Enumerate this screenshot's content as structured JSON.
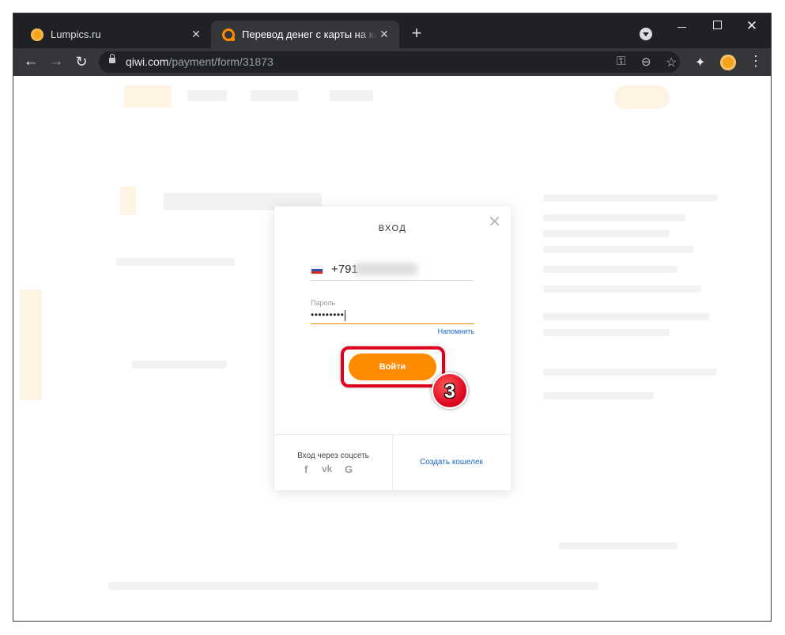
{
  "browser": {
    "tabs": [
      {
        "title": "Lumpics.ru",
        "close": "✕",
        "favicon": "lumpics-favicon"
      },
      {
        "title": "Перевод денег с карты на карту",
        "close": "✕",
        "favicon": "qiwi-favicon"
      }
    ],
    "new_tab": "+",
    "window_controls": {
      "close": "✕"
    },
    "url": {
      "host": "qiwi.com",
      "path": "/payment/form/31873"
    },
    "icons": {
      "back": "←",
      "forward": "→",
      "reload": "↻",
      "key": "⚿",
      "zoom": "⊖",
      "star": "☆",
      "extensions": "✦",
      "menu": "⋮"
    }
  },
  "modal": {
    "title": "ВХОД",
    "close": "✕",
    "phone_prefix": "+791",
    "password_label": "Пароль",
    "password_value": "•••••••••",
    "remind_link": "Напомнить",
    "login_button": "Войти",
    "step_badge": "3",
    "social_label": "Вход через соцсеть",
    "social": {
      "facebook": "f",
      "vk": "vk",
      "google": "G"
    },
    "create_wallet": "Создать кошелек"
  },
  "colors": {
    "accent": "#ff8c00",
    "link": "#1a64bf",
    "highlight": "#e0001b"
  }
}
